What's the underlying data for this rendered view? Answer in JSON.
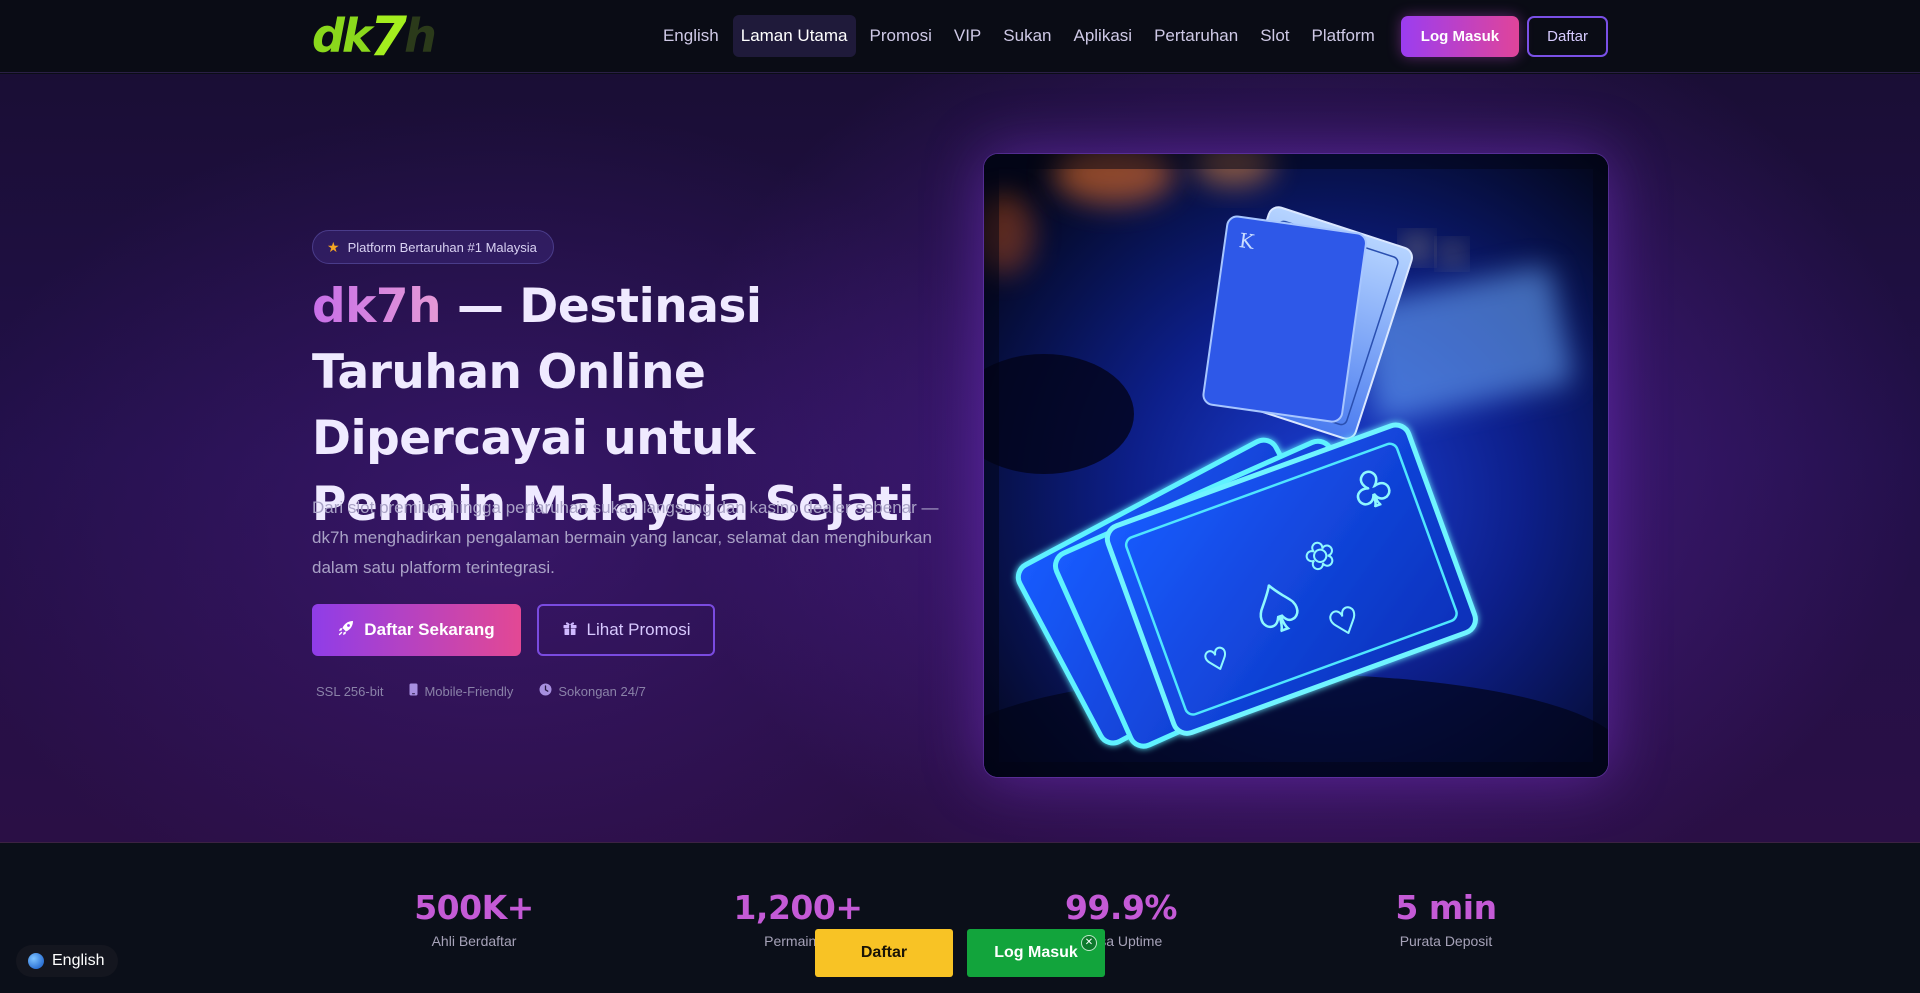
{
  "brand": {
    "logo_text_dk": "dk",
    "logo_text_7": "7",
    "logo_text_h": "h"
  },
  "nav": {
    "items": [
      {
        "label": "English",
        "active": false
      },
      {
        "label": "Laman Utama",
        "active": true
      },
      {
        "label": "Promosi",
        "active": false
      },
      {
        "label": "VIP",
        "active": false
      },
      {
        "label": "Sukan",
        "active": false
      },
      {
        "label": "Aplikasi",
        "active": false
      },
      {
        "label": "Pertaruhan",
        "active": false
      },
      {
        "label": "Slot",
        "active": false
      },
      {
        "label": "Platform",
        "active": false
      }
    ],
    "login_label": "Log Masuk",
    "register_label": "Daftar"
  },
  "hero": {
    "badge": "Platform Bertaruhan #1 Malaysia",
    "headline_brand": "dk7h",
    "headline_rest": " — Destinasi Taruhan Online Dipercayai untuk Pemain Malaysia Sejati",
    "subtext": "Dari slot premium hingga pertaruhan sukan langsung dan kasino dealer sebenar — dk7h menghadirkan pengalaman bermain yang lancar, selamat dan menghiburkan dalam satu platform terintegrasi.",
    "cta_primary": "Daftar Sekarang",
    "cta_secondary": "Lihat Promosi",
    "trust": [
      "SSL 256-bit",
      "Mobile-Friendly",
      "Sokongan 24/7"
    ]
  },
  "stats": [
    {
      "value": "500K+",
      "label": "Ahli Berdaftar"
    },
    {
      "value": "1,200+",
      "label": "Permainan"
    },
    {
      "value": "99.9%",
      "label": "Masa Uptime"
    },
    {
      "value": "5 min",
      "label": "Purata Deposit"
    }
  ],
  "floating": {
    "language": "English",
    "daftar": "Daftar",
    "login": "Log Masuk",
    "close_symbol": "✕"
  },
  "colors": {
    "accent_gradient_start": "#9b3df0",
    "accent_gradient_end": "#e0449a",
    "logo_green": "#8ad81c",
    "stat_value": "#c45ad6",
    "float_daftar": "#f8c325",
    "float_login": "#12a43c"
  },
  "icons": {
    "badge": "star-icon",
    "cta_primary": "rocket-icon",
    "cta_secondary": "gift-icon",
    "trust_mobile": "mobile-icon",
    "trust_support": "clock-icon",
    "language": "globe-icon"
  }
}
